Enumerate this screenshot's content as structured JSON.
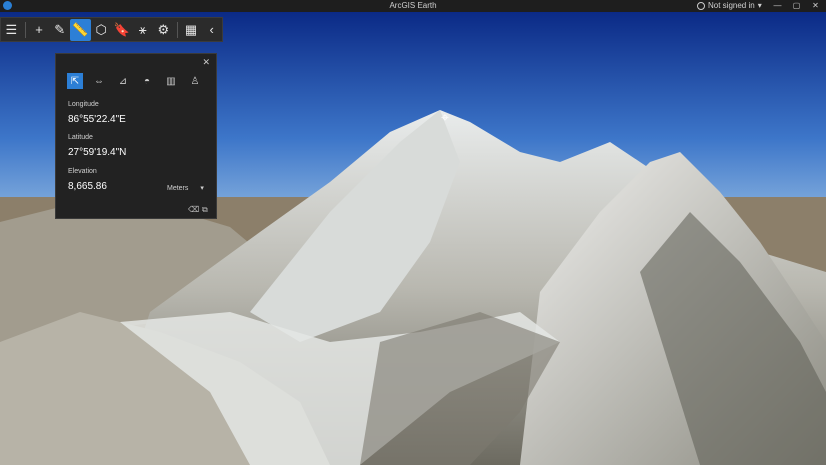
{
  "window": {
    "title": "ArcGIS Earth",
    "user_status": "Not signed in",
    "user_chevron": "▾",
    "min": "—",
    "max": "▢",
    "close": "✕"
  },
  "toolbar": {
    "menu_icon": "☰",
    "add_icon": "+",
    "draw_icon": "✎",
    "measure_icon": "📏",
    "cube_icon": "⬡",
    "bookmark_icon": "🔖",
    "share_icon": "⚹",
    "settings_icon": "⚙",
    "grid_icon": "▦",
    "collapse_icon": "‹"
  },
  "panel": {
    "close": "✕",
    "tools": [
      "⇱",
      "⇔",
      "⊿",
      "◓",
      "▥",
      "♙"
    ],
    "longitude_label": "Longitude",
    "longitude_value": "86°55'22.4\"E",
    "latitude_label": "Latitude",
    "latitude_value": "27°59'19.4\"N",
    "elevation_label": "Elevation",
    "elevation_value": "8,665.86",
    "unit": "Meters",
    "unit_chevron": "▾",
    "clear_icon": "⌫",
    "copy_icon": "⧉"
  },
  "marker": {
    "crosshair": "⌖"
  },
  "colors": {
    "accent": "#2c7fd6",
    "panel_bg": "#222222",
    "titlebar_bg": "#1e1e1e"
  }
}
